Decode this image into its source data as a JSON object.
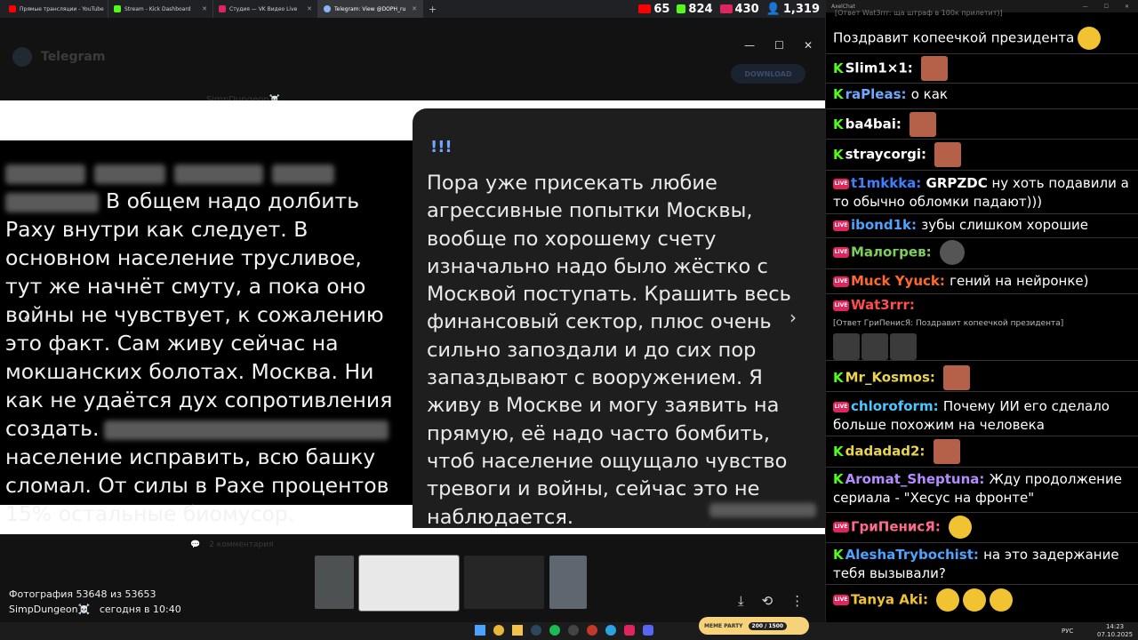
{
  "tabs": [
    {
      "label": "Прямые трансляции - YouTube",
      "color": "#ff0000",
      "active": false
    },
    {
      "label": "Stream - Kick Dashboard",
      "color": "#53fc18",
      "active": false
    },
    {
      "label": "Студия — VK Видео Live",
      "color": "#e0245e",
      "active": false
    },
    {
      "label": "Telegram: View @DOPH_ru",
      "color": "#8ab4f8",
      "active": true
    }
  ],
  "counters": {
    "youtube": "65",
    "kick": "824",
    "vk": "430",
    "total": "1,319",
    "colors": {
      "youtube": "#ff0000",
      "kick": "#53fc18",
      "vk": "#e0245e"
    }
  },
  "telegram": {
    "app_name": "Telegram",
    "download_label": "DOWNLOAD",
    "channel_owner": "SimpDungeon☠️",
    "comment_bar": "2 комментария"
  },
  "photo": {
    "left_lines": [
      {
        "blur": 1,
        "text": ""
      },
      {
        "blur": 2,
        "text": "В общем надо долбить"
      },
      {
        "blur": 0,
        "text": "Раху внутри как следует. В"
      },
      {
        "blur": 0,
        "text": "основном население трусливое,"
      },
      {
        "blur": 0,
        "text": "тут же начнёт смуту, а пока оно"
      },
      {
        "blur": 0,
        "text": "войны не чувствует, к сожалению"
      },
      {
        "blur": 0,
        "text": "это факт. Сам живу сейчас на"
      },
      {
        "blur": 0,
        "text": "мокшанских болотах. Москва. Ни"
      },
      {
        "blur": 0,
        "text": "как не удаётся дух сопротивления"
      },
      {
        "blur": 3,
        "text": "создать."
      },
      {
        "blur": 0,
        "text": "население исправить, всю башку"
      },
      {
        "blur": 0,
        "text": "сломал. От силы в Рахе процентов"
      },
      {
        "blur": 0,
        "text": "15% остальные биомусор."
      }
    ],
    "right_header": "!!!",
    "right_lines": [
      "Пора уже присекать любие",
      "агрессивные попытки Москвы,",
      "вообще по хорошему счету",
      "изначально надо было жёстко с",
      "Москвой поступать. Крашить весь",
      "финансовый сектор, плюс очень",
      "сильно запоздали и до сих пор",
      "запаздывают с вооружением. Я",
      "живу в Москве и могу заявить на",
      "прямую, её надо часто бомбить,",
      "чтоб население ощущало чувство",
      "тревоги и войны, сейчас это не",
      "наблюдается."
    ]
  },
  "photo_info": {
    "counter": "Фотография 53648 из 53653",
    "author": "SimpDungeon☠️",
    "time": "сегодня в 10:40"
  },
  "chat": {
    "window_title": "AxelChat",
    "top_reply": "[Ответ Wat3rrr: ща штраф в 100к прилетит)]",
    "messages": [
      {
        "platform": "none",
        "user": "",
        "color": "#ffffff",
        "text": "Поздравит копеечкой президента",
        "emote": "smile"
      },
      {
        "platform": "kick",
        "user": "Slim1×1:",
        "color": "#ffffff",
        "text": "",
        "emote": "face"
      },
      {
        "platform": "kick",
        "user": "raPleas:",
        "color": "#6ea8ff",
        "text": "о как",
        "emote": ""
      },
      {
        "platform": "kick",
        "user": "ba4bai:",
        "color": "#ffffff",
        "text": "",
        "emote": "face"
      },
      {
        "platform": "kick",
        "user": "straycorgi:",
        "color": "#ffffff",
        "text": "",
        "emote": "face"
      },
      {
        "platform": "vk",
        "user": "t1mkkka:",
        "color": "#3f7fff",
        "text": "GRPZDC ну хоть подавили а то обычно обломки падают)))",
        "emote": ""
      },
      {
        "platform": "vk",
        "user": "ibond1k:",
        "color": "#4da3ff",
        "text": "зубы слишком хорошие",
        "emote": ""
      },
      {
        "platform": "vk",
        "user": "Малогрев:",
        "color": "#7ccf5a",
        "text": "",
        "emote": "round"
      },
      {
        "platform": "vk",
        "user": "Muck Yyuck:",
        "color": "#ff6a2b",
        "text": "гений на нейронке)",
        "emote": ""
      },
      {
        "platform": "vk",
        "user": "Wat3rrr:",
        "color": "#ff4d4d",
        "text": "",
        "emote": ""
      },
      {
        "platform": "kick",
        "user": "Mr_Kosmos:",
        "color": "#e8d44d",
        "text": "",
        "emote": "face"
      },
      {
        "platform": "vk",
        "user": "chloroform:",
        "color": "#4dc7ff",
        "text": "Почему ИИ его сделало больше похожим на человека",
        "emote": ""
      },
      {
        "platform": "kick",
        "user": "dadadad2:",
        "color": "#e8d44d",
        "text": "",
        "emote": "face"
      },
      {
        "platform": "kick",
        "user": "Aromat_Sheptuna:",
        "color": "#b58cff",
        "text": "Жду продолжение сериала - \"Хесус на фронте\"",
        "emote": ""
      },
      {
        "platform": "vk",
        "user": "ГриПенисЯ:",
        "color": "#ff6a8a",
        "text": "",
        "emote": "smile"
      },
      {
        "platform": "kick",
        "user": "AleshaTrybochist:",
        "color": "#4da3ff",
        "text": "на это задержание тебя вызывали?",
        "emote": ""
      },
      {
        "platform": "vk",
        "user": "Tanya Aki:",
        "color": "#f1c232",
        "text": "",
        "emote": "smile"
      }
    ],
    "wat_reply": "[Ответ ГриПенисЯ: Поздравит копеечкой президента]"
  },
  "taskbar": {
    "banner": "MEME PARTY",
    "progress": "200 / 1500",
    "lang": "РУС",
    "time": "14:23",
    "date": "07.10.2025"
  }
}
